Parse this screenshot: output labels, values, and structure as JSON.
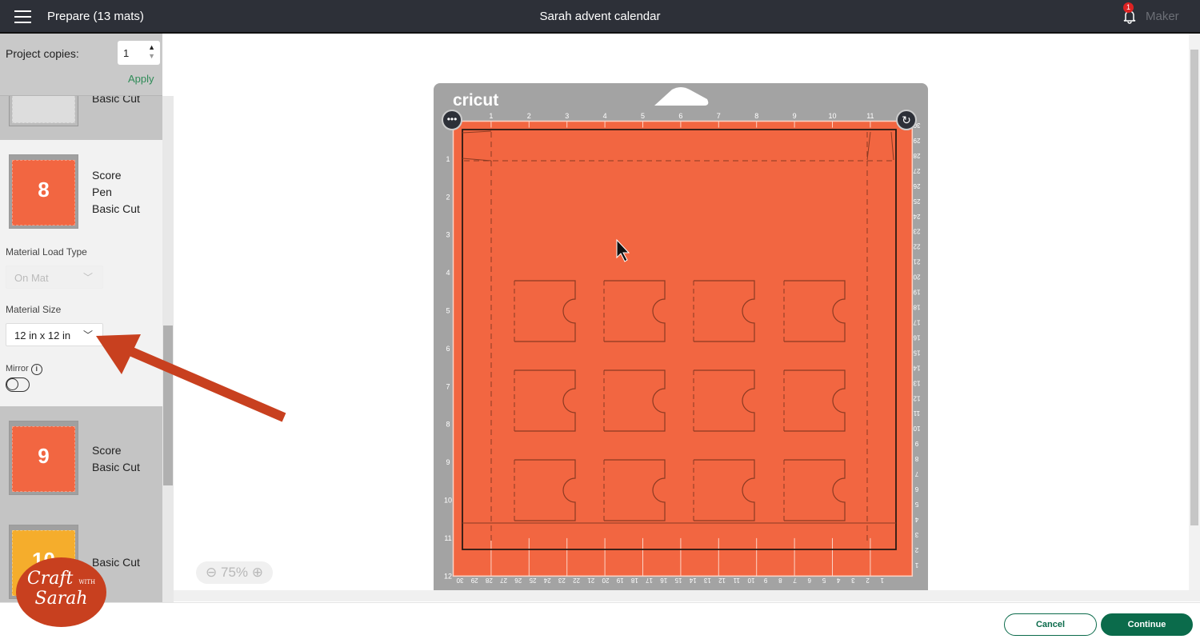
{
  "header": {
    "title": "Prepare (13 mats)",
    "project": "Sarah advent calendar",
    "notifications": "1",
    "machine": "Maker"
  },
  "copies": {
    "label": "Project copies:",
    "value": "1",
    "apply": "Apply"
  },
  "mats": [
    {
      "ops": [
        "Basic Cut"
      ]
    },
    {
      "number": "8",
      "ops": [
        "Score",
        "Pen",
        "Basic Cut"
      ],
      "color": "#f26641"
    },
    {
      "number": "9",
      "ops": [
        "Score",
        "Basic Cut"
      ],
      "color": "#f26641"
    },
    {
      "number": "10",
      "ops": [
        "Basic Cut"
      ],
      "color": "#f5ad2c"
    }
  ],
  "settings": {
    "load_type_label": "Material Load Type",
    "load_type": "On Mat",
    "size_label": "Material Size",
    "size": "12 in x 12 in",
    "mirror_label": "Mirror",
    "mirror_on": false
  },
  "mat": {
    "brand": "cricut",
    "color": "#f26641",
    "top_ruler": [
      "1",
      "2",
      "3",
      "4",
      "5",
      "6",
      "7",
      "8",
      "9",
      "10",
      "11"
    ],
    "left_ruler": [
      "1",
      "2",
      "3",
      "4",
      "5",
      "6",
      "7",
      "8",
      "9",
      "10",
      "11",
      "12"
    ],
    "cm_ruler": [
      "30",
      "29",
      "28",
      "27",
      "26",
      "25",
      "24",
      "23",
      "22",
      "21",
      "20",
      "19",
      "18",
      "17",
      "16",
      "15",
      "14",
      "13",
      "12",
      "11",
      "10",
      "9",
      "8",
      "7",
      "6",
      "5",
      "4",
      "3",
      "2",
      "1"
    ]
  },
  "zoom": {
    "value": "75%"
  },
  "footer": {
    "cancel": "Cancel",
    "continue": "Continue"
  },
  "watermark": {
    "line1": "Craft",
    "with": "WITH",
    "line2": "Sarah"
  },
  "colors": {
    "accent": "#0b6b4b",
    "annotation_arrow": "#c8401f"
  }
}
